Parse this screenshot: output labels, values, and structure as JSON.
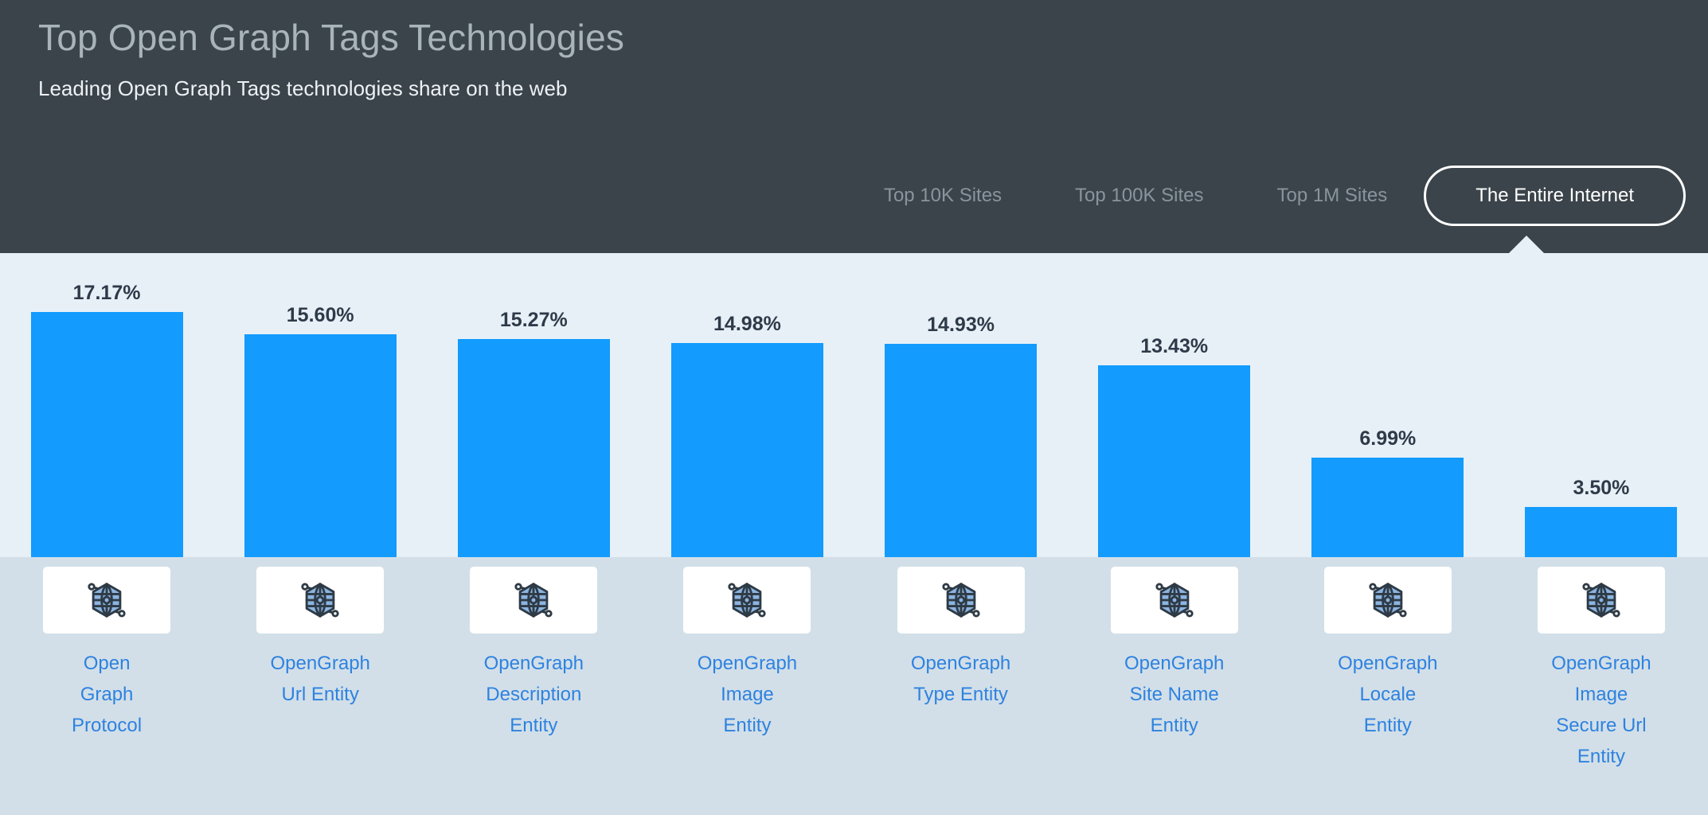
{
  "header": {
    "title": "Top Open Graph Tags Technologies",
    "subtitle": "Leading Open Graph Tags technologies share on the web",
    "background_color": "#3B444B",
    "title_color": "#A9B3BA",
    "subtitle_color": "#EDF1F4"
  },
  "tabs": [
    {
      "label": "Top 10K Sites",
      "active": false
    },
    {
      "label": "Top 100K Sites",
      "active": false
    },
    {
      "label": "Top 1M Sites",
      "active": false
    },
    {
      "label": "The Entire Internet",
      "active": true
    }
  ],
  "colors": {
    "bar": "#139BFE",
    "chart_background": "#E7F0F7",
    "legend_background": "#D2DFE8",
    "value_label": "#2E3A49",
    "legend_label": "#2E82E0",
    "icon_card": "#FFFFFF",
    "icon_fill": "#8CB4E0",
    "icon_stroke": "#2E3A45"
  },
  "icon": {
    "name": "open-graph-hexagon-globe-icon"
  },
  "chart_data": {
    "type": "bar",
    "title": "Top Open Graph Tags Technologies",
    "subtitle": "Leading Open Graph Tags technologies share on the web",
    "xlabel": "",
    "ylabel": "",
    "ylim": [
      0,
      17.17
    ],
    "grid": false,
    "legend_position": "none",
    "value_suffix": "%",
    "categories": [
      "Open Graph Protocol",
      "OpenGraph Url Entity",
      "OpenGraph Description Entity",
      "OpenGraph Image Entity",
      "OpenGraph Type Entity",
      "OpenGraph Site Name Entity",
      "OpenGraph Locale Entity",
      "OpenGraph Image Secure Url Entity"
    ],
    "values": [
      17.17,
      15.6,
      15.27,
      14.98,
      14.93,
      13.43,
      6.99,
      3.5
    ],
    "value_labels": [
      "17.17%",
      "15.60%",
      "15.27%",
      "14.98%",
      "14.93%",
      "13.43%",
      "6.99%",
      "3.50%"
    ]
  }
}
